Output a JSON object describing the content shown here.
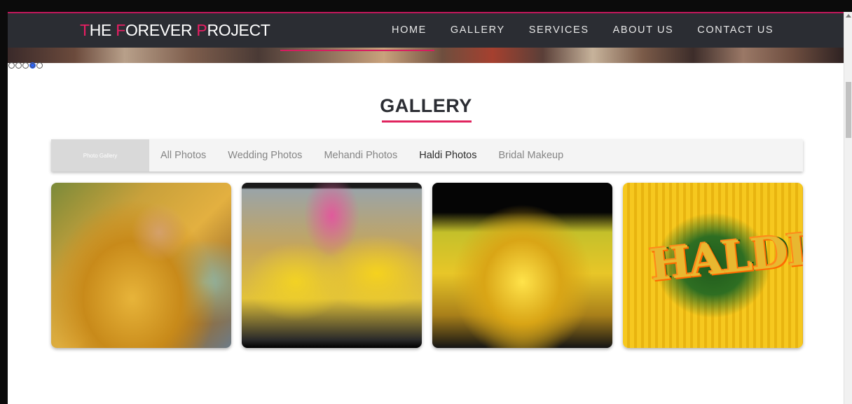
{
  "site": {
    "logo": {
      "letter1": "T",
      "part1": "HE ",
      "letter2": "F",
      "part2": "OREVER ",
      "letter3": "P",
      "part3": "ROJECT"
    },
    "accent_color": "#e91e63",
    "header_color": "#2b2d33"
  },
  "nav": {
    "items": [
      "HOME",
      "GALLERY",
      "SERVICES",
      "ABOUT US",
      "CONTACT US"
    ]
  },
  "carousel": {
    "slide_count": 5,
    "active_index": 3
  },
  "gallery": {
    "title": "GALLERY",
    "filter_label": "Photo Gallery",
    "tabs": [
      "All Photos",
      "Wedding Photos",
      "Mehandi Photos",
      "Haldi Photos",
      "Bridal Makeup"
    ],
    "active_tab": "Haldi Photos",
    "photo_sign_text": "HALDI"
  }
}
